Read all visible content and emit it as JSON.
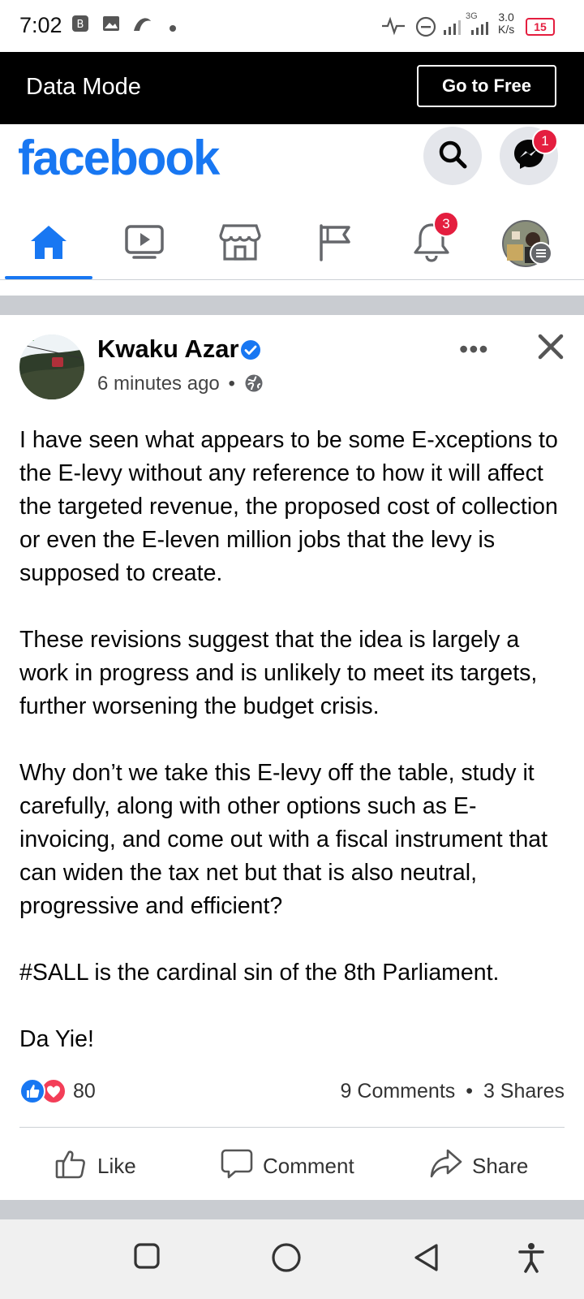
{
  "status_bar": {
    "time": "7:02",
    "speed_value": "3.0",
    "speed_unit": "K/s",
    "network_label": "3G",
    "battery": "15"
  },
  "data_bar": {
    "title": "Data Mode",
    "go_free_label": "Go to Free"
  },
  "header": {
    "logo": "facebook",
    "messenger_badge": "1"
  },
  "nav": {
    "notifications_badge": "3"
  },
  "post": {
    "author": "Kwaku Azar",
    "time": "6 minutes ago",
    "privacy_separator": "•",
    "more_label": "•••",
    "paragraphs": [
      "I have seen what appears to be some E-xceptions to the E-levy without any reference to how it will affect the targeted revenue, the proposed cost of collection or even the E-leven million jobs that the levy is supposed to create.",
      "These revisions suggest that the idea is largely a work in progress and is unlikely to meet its targets, further worsening the budget crisis.",
      "Why don’t we take this E-levy off the table, study it carefully, along with other options such as E-invoicing, and come out with a fiscal instrument that can widen the tax net but that is also neutral, progressive and efficient?",
      "#SALL is the cardinal sin of the 8th Parliament.",
      "Da Yie!"
    ],
    "reaction_count": "80",
    "comments": "9 Comments",
    "meta_separator": "•",
    "shares": "3 Shares"
  },
  "actions": {
    "like": "Like",
    "comment": "Comment",
    "share": "Share"
  },
  "colors": {
    "brand": "#1877f2",
    "badge": "#e41e3f"
  }
}
